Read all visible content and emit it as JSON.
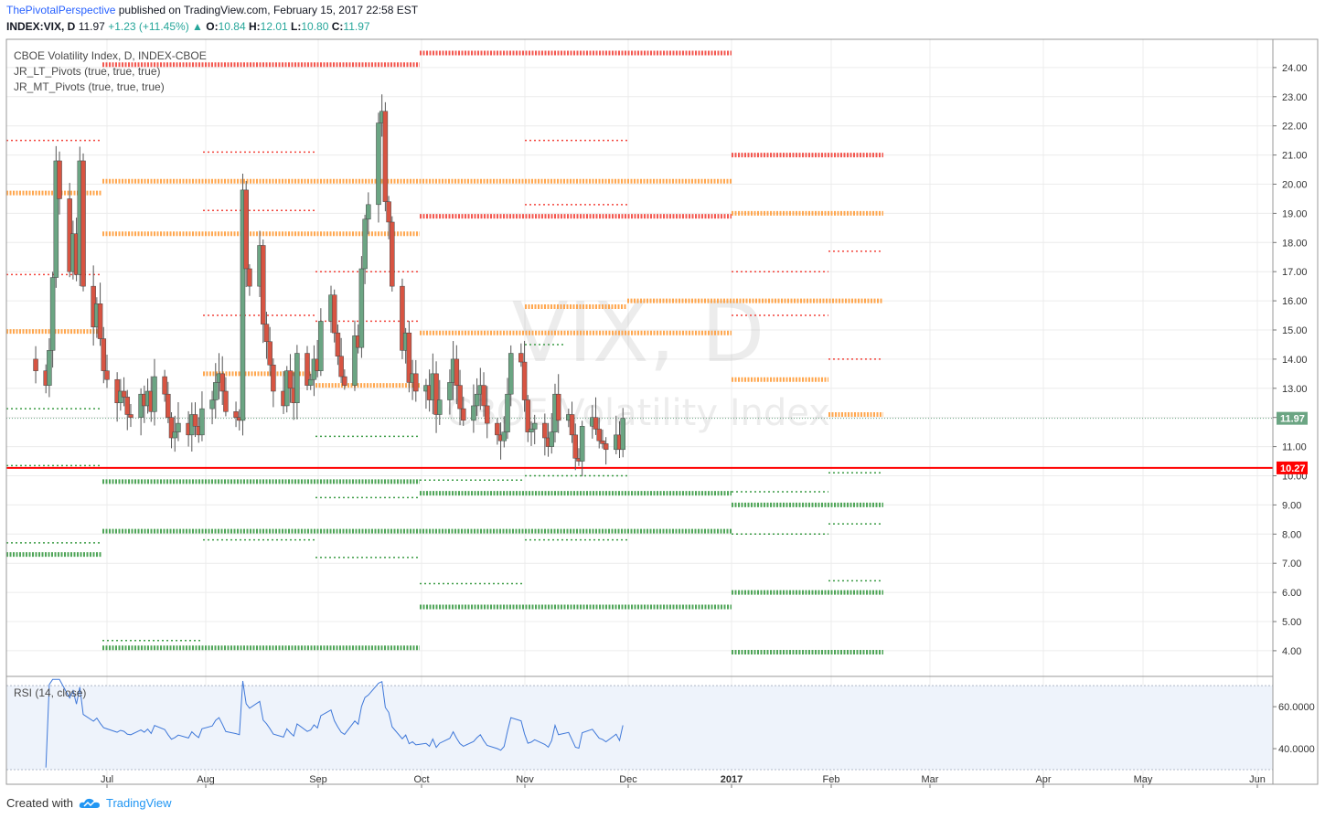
{
  "header": {
    "author": "ThePivotalPerspective",
    "published": " published on TradingView.com, February 15, 2017 22:58 EST",
    "symbol_line": "INDEX:VIX, D",
    "last": "11.97",
    "change": "+1.23 (+11.45%)",
    "o_label": "O:",
    "o": "10.84",
    "h_label": "H:",
    "h": "12.01",
    "l_label": "L:",
    "l": "10.80",
    "c_label": "C:",
    "c": "11.97"
  },
  "legend": {
    "title": "CBOE Volatility Index, D, INDEX-CBOE",
    "ind1": "JR_LT_Pivots (true, true, true)",
    "ind2": "JR_MT_Pivots (true, true, true)",
    "rsi": "RSI (14, close)"
  },
  "watermark": {
    "big": "VIX, D",
    "small": "CBOE Volatility Index"
  },
  "price_axis": {
    "ticks": [
      "24.00",
      "23.00",
      "22.00",
      "21.00",
      "20.00",
      "19.00",
      "18.00",
      "17.00",
      "16.00",
      "15.00",
      "14.00",
      "13.00",
      "12.00",
      "11.00",
      "10.00",
      "9.00",
      "8.00",
      "7.00",
      "6.00",
      "5.00",
      "4.00"
    ],
    "last_badge": "11.97",
    "line_badge": "10.27"
  },
  "rsi_axis": {
    "ticks": [
      "60.0000",
      "40.0000"
    ]
  },
  "time_axis": {
    "months": [
      "Jul",
      "Aug",
      "Sep",
      "Oct",
      "Nov",
      "Dec",
      "2017",
      "Feb",
      "Mar",
      "Apr",
      "May",
      "Jun"
    ]
  },
  "footer": {
    "created_with": "Created with",
    "brand": "TradingView"
  },
  "colors": {
    "up": "#6ba583",
    "down": "#d75442",
    "red_line": "#ff0000",
    "badge_green": "#6ba583",
    "badge_red": "#ff0000",
    "lt_resist": "#f2453d",
    "mt_resist": "#ff9e3d",
    "support": "#3c9c46",
    "rsi_line": "#3f78d9"
  },
  "chart_data": {
    "type": "candlestick",
    "title": "CBOE Volatility Index, D, INDEX-CBOE",
    "ylim": [
      3.0,
      24.9
    ],
    "start_date": "2016-06-10",
    "close_path": [
      13.6,
      13.1,
      14.3,
      16.8,
      20.8,
      19.5,
      17.0,
      18.3,
      16.9,
      20.8,
      16.5,
      15.1,
      15.9,
      14.7,
      13.6,
      13.3,
      12.5,
      12.9,
      12.7,
      12.1,
      12.0,
      12.8,
      12.4,
      12.9,
      12.2,
      13.4,
      12.8,
      12.0,
      11.3,
      11.5,
      11.8,
      11.4,
      12.1,
      11.7,
      11.4,
      12.3,
      12.6,
      13.2,
      13.5,
      12.9,
      12.2,
      12.0,
      11.9,
      19.8,
      17.1,
      16.5,
      17.9,
      15.2,
      14.6,
      13.8,
      12.9,
      12.4,
      13.6,
      13.0,
      12.5,
      14.2,
      13.1,
      13.3,
      14.0,
      13.6,
      15.3,
      16.2,
      14.9,
      14.1,
      13.4,
      13.1,
      14.8,
      14.4,
      17.1,
      18.8,
      19.3,
      22.1,
      22.5,
      19.4,
      18.7,
      16.5,
      14.3,
      14.9,
      13.2,
      13.5,
      12.9,
      13.1,
      12.6,
      13.5,
      12.1,
      12.6,
      13.2,
      14.0,
      13.1,
      12.3,
      11.9,
      12.4,
      12.8,
      13.1,
      12.4,
      11.8,
      11.4,
      11.2,
      11.5,
      12.8,
      14.2,
      13.9,
      12.6,
      11.5,
      11.6,
      11.8,
      11.3,
      11.0,
      11.5,
      12.8,
      11.9,
      12.1,
      11.4,
      10.6,
      10.5,
      11.7,
      12.0,
      11.6,
      11.2,
      11.1,
      10.9,
      11.4,
      10.9,
      11.97
    ],
    "pivot_levels": {
      "lt_resistance": [
        24.1,
        24.5,
        21.0,
        18.9
      ],
      "mt_resistance": [
        20.1,
        19.7,
        18.3,
        14.9,
        19.0,
        16.0,
        13.3,
        12.1
      ],
      "support": [
        9.8,
        9.4,
        9.0,
        8.1,
        7.3,
        6.0,
        5.5,
        4.1,
        3.95
      ]
    },
    "horizontal_line": 10.27,
    "rsi": {
      "name": "RSI (14, close)",
      "ylim": [
        30,
        74
      ],
      "ticks": [
        60,
        40
      ]
    }
  }
}
